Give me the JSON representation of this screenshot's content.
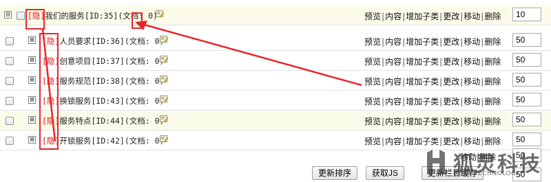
{
  "ops": [
    "预览",
    "内容",
    "增加子类",
    "更改",
    "移动",
    "删除"
  ],
  "ops_sep": "|",
  "root": {
    "tag": "[隐]",
    "name": "我们的服务",
    "id": "[ID:35]",
    "doc": "(文档: 0)",
    "sort": "10",
    "expander": "⊟"
  },
  "children": [
    {
      "tag": "[隐]",
      "name": "人员要求",
      "id": "[ID:36]",
      "doc": "(文档: 0)",
      "sort": "50",
      "expander": "⊞"
    },
    {
      "tag": "[隐]",
      "name": "创意项目",
      "id": "[ID:37]",
      "doc": "(文档: 0)",
      "sort": "50",
      "expander": "⊞"
    },
    {
      "tag": "[隐]",
      "name": "服务规范",
      "id": "[ID:38]",
      "doc": "(文档: 0)",
      "sort": "50",
      "expander": "⊞"
    },
    {
      "tag": "[隐]",
      "name": "换锁服务",
      "id": "[ID:43]",
      "doc": "(文档: 0)",
      "sort": "50",
      "expander": "⊞"
    },
    {
      "tag": "[隐]",
      "name": "服务特点",
      "id": "[ID:44]",
      "doc": "(文档: 0)",
      "sort": "50",
      "expander": "⊞"
    },
    {
      "tag": "[隐]",
      "name": "开锁服务",
      "id": "[ID:42]",
      "doc": "(文档: 0)",
      "sort": "50",
      "expander": "⊞"
    }
  ],
  "partial_row": {
    "ops_text": "移动|删除",
    "sort": "50"
  },
  "footer": {
    "update_sort": "更新排序",
    "get_js": "获取JS",
    "update_cache": "更新栏目缓存",
    "bottom_sort": "50"
  },
  "watermark": {
    "brand": "狐灵科技",
    "sub": "FOXL TECHNOLOGY"
  },
  "colors": {
    "hidden_tag": "#dd1111",
    "callout": "#e8262a",
    "highlight_row": "#fbfbe9"
  },
  "icons": {
    "edit": "edit-icon",
    "checkbox": "checkbox",
    "expand": "expand-icon",
    "collapse": "collapse-icon"
  }
}
